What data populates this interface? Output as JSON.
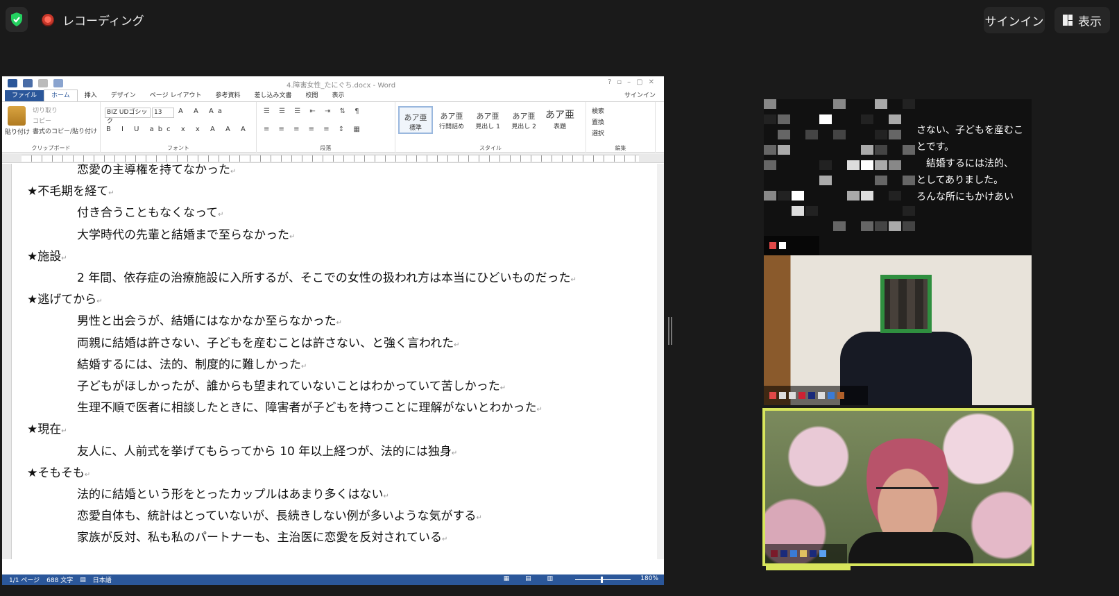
{
  "zoom": {
    "recording_label": "レコーディング",
    "signin_label": "サインイン",
    "view_label": "表示"
  },
  "word": {
    "title": "4.障害女性_たにぐち.docx - Word",
    "tabs": [
      "ファイル",
      "ホーム",
      "挿入",
      "デザイン",
      "ページ レイアウト",
      "参考資料",
      "差し込み文書",
      "校閲",
      "表示"
    ],
    "signin": "サインイン",
    "ribbon": {
      "clipboard": {
        "paste": "貼り付け",
        "cut": "切り取り",
        "copy": "コピー",
        "format_painter": "書式のコピー/貼り付け",
        "label": "クリップボード"
      },
      "font": {
        "name": "BIZ UDゴシック",
        "size": "13",
        "label": "フォント"
      },
      "paragraph": {
        "label": "段落"
      },
      "styles": {
        "label": "スタイル",
        "items": [
          "標準",
          "行間詰め",
          "見出し 1",
          "見出し 2",
          "表題"
        ],
        "sample": "あア亜"
      },
      "editing": {
        "label": "編集",
        "find": "検索",
        "replace": "置換",
        "select": "選択"
      }
    },
    "document_lines": [
      {
        "text": "恋愛の主導権を持てなかった",
        "indent": true
      },
      {
        "text": "★不毛期を経て",
        "indent": false
      },
      {
        "text": "付き合うこともなくなって",
        "indent": true
      },
      {
        "text": "大学時代の先輩と結婚まで至らなかった",
        "indent": true
      },
      {
        "text": "★施設",
        "indent": false
      },
      {
        "text": "2 年間、依存症の治療施設に入所するが、そこでの女性の扱われ方は本当にひどいものだった",
        "indent": true
      },
      {
        "text": "★逃げてから",
        "indent": false
      },
      {
        "text": "男性と出会うが、結婚にはなかなか至らなかった",
        "indent": true
      },
      {
        "text": "両親に結婚は許さない、子どもを産むことは許さない、と強く言われた",
        "indent": true
      },
      {
        "text": "結婚するには、法的、制度的に難しかった",
        "indent": true
      },
      {
        "text": "子どもがほしかったが、誰からも望まれていないことはわかっていて苦しかった",
        "indent": true
      },
      {
        "text": "生理不順で医者に相談したときに、障害者が子どもを持つことに理解がないとわかった",
        "indent": true
      },
      {
        "text": "★現在",
        "indent": false
      },
      {
        "text": "友人に、人前式を挙げてもらってから 10 年以上経つが、法的には独身",
        "indent": true
      },
      {
        "text": "★そもそも",
        "indent": false
      },
      {
        "text": "法的に結婚という形をとったカップルはあまり多くはない",
        "indent": true
      },
      {
        "text": "恋愛自体も、統計はとっていないが、長続きしない例が多いような気がする",
        "indent": true
      },
      {
        "text": "家族が反対、私も私のパートナーも、主治医に恋愛を反対されている",
        "indent": true
      }
    ],
    "status": {
      "page": "1/1 ページ",
      "words": "688 文字",
      "language": "日本語",
      "zoom": "180%"
    }
  },
  "captions": [
    "さない、子どもを産むこ",
    "とです。",
    "結婚するには法的、",
    "としてありました。",
    "ろんな所にもかけあい"
  ],
  "colors": {
    "word_blue": "#2b579a",
    "active_speaker": "#d8e65c",
    "background": "#1a1a1a"
  }
}
